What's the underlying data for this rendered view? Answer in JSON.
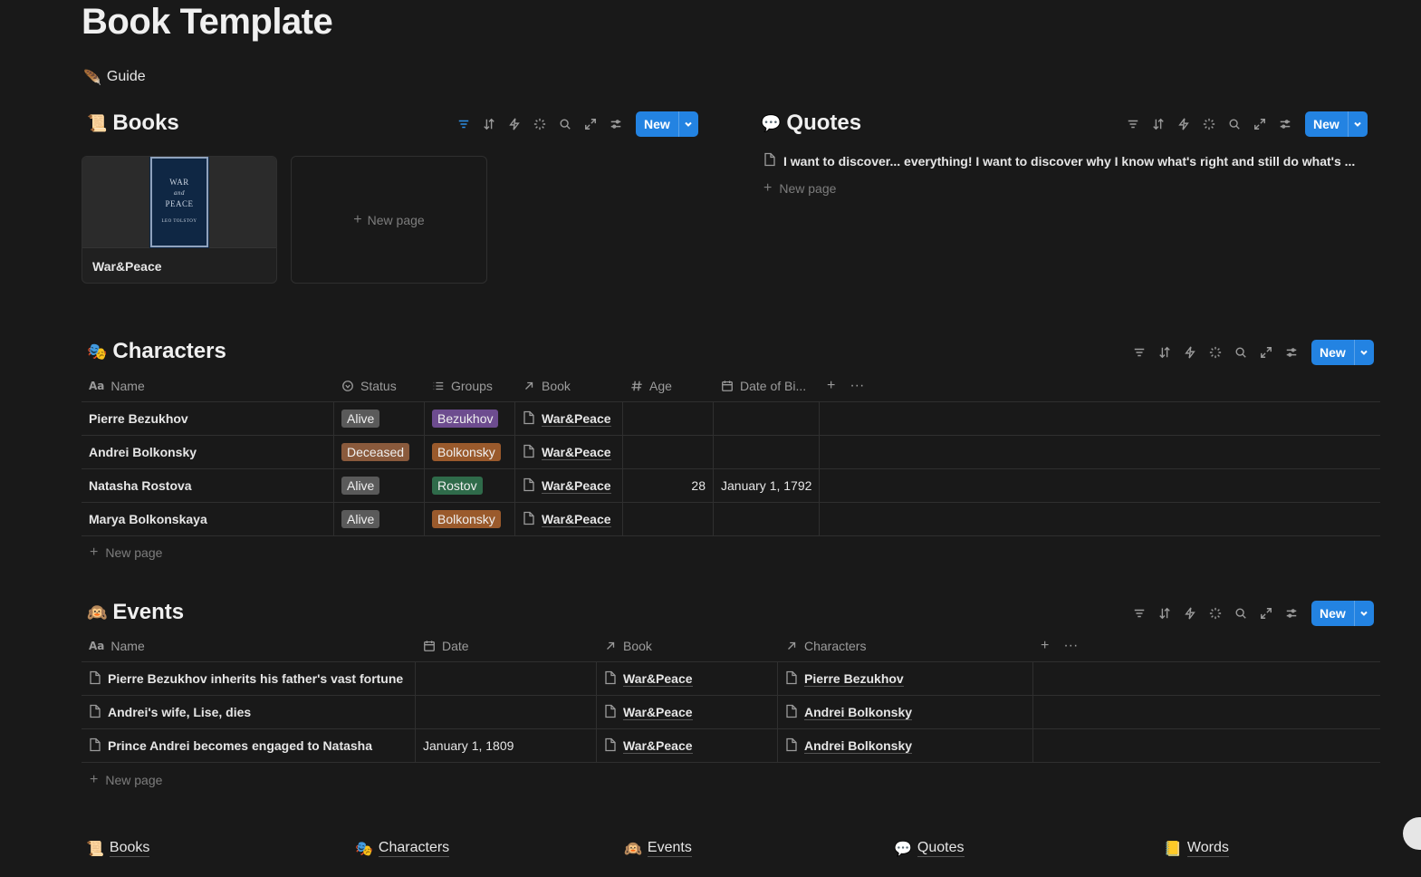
{
  "page": {
    "title": "Book Template",
    "guide_label": "Guide"
  },
  "books_db": {
    "title": "Books",
    "new_label": "New",
    "cards": [
      {
        "title": "War&Peace",
        "cover_lines": [
          "WAR",
          "and",
          "PEACE",
          "LEO TOLSTOY"
        ]
      }
    ],
    "new_page_label": "New page"
  },
  "quotes_db": {
    "title": "Quotes",
    "new_label": "New",
    "items": [
      "I want to discover... everything! I want to discover why I know what's right and still do what's ..."
    ],
    "new_page_label": "New page"
  },
  "characters_db": {
    "title": "Characters",
    "new_label": "New",
    "columns": [
      "Name",
      "Status",
      "Groups",
      "Book",
      "Age",
      "Date of Bi..."
    ],
    "rows": [
      {
        "name": "Pierre Bezukhov",
        "status": "Alive",
        "group": "Bezukhov",
        "book": "War&Peace",
        "age": "",
        "dob": ""
      },
      {
        "name": "Andrei Bolkonsky",
        "status": "Deceased",
        "group": "Bolkonsky",
        "book": "War&Peace",
        "age": "",
        "dob": ""
      },
      {
        "name": "Natasha Rostova",
        "status": "Alive",
        "group": "Rostov",
        "book": "War&Peace",
        "age": "28",
        "dob": "January 1, 1792"
      },
      {
        "name": "Marya Bolkonskaya",
        "status": "Alive",
        "group": "Bolkonsky",
        "book": "War&Peace",
        "age": "",
        "dob": ""
      }
    ],
    "new_page_label": "New page"
  },
  "events_db": {
    "title": "Events",
    "new_label": "New",
    "columns": [
      "Name",
      "Date",
      "Book",
      "Characters"
    ],
    "rows": [
      {
        "name": "Pierre Bezukhov inherits his father's vast fortune",
        "date": "",
        "book": "War&Peace",
        "character": "Pierre Bezukhov"
      },
      {
        "name": "Andrei's wife, Lise, dies",
        "date": "",
        "book": "War&Peace",
        "character": "Andrei Bolkonsky"
      },
      {
        "name": "Prince Andrei becomes engaged to Natasha",
        "date": "January 1, 1809",
        "book": "War&Peace",
        "character": "Andrei Bolkonsky"
      }
    ],
    "new_page_label": "New page"
  },
  "footer_links": [
    "Books",
    "Characters",
    "Events",
    "Quotes",
    "Words"
  ],
  "colors": {
    "background": "#191919",
    "accent": "#2383e2",
    "tag_gray": "#5a5a5a",
    "tag_brown": "#8a5a3c",
    "tag_purple": "#6d4c8f",
    "tag_orange": "#9a5a2c",
    "tag_green": "#2f6b4a"
  },
  "icons": {
    "guide": "quill-icon",
    "books": "scroll-icon",
    "quotes": "speech-bubble-icon",
    "characters": "performing-arts-icon",
    "events": "monkey-icon",
    "words": "notepad-icon"
  }
}
